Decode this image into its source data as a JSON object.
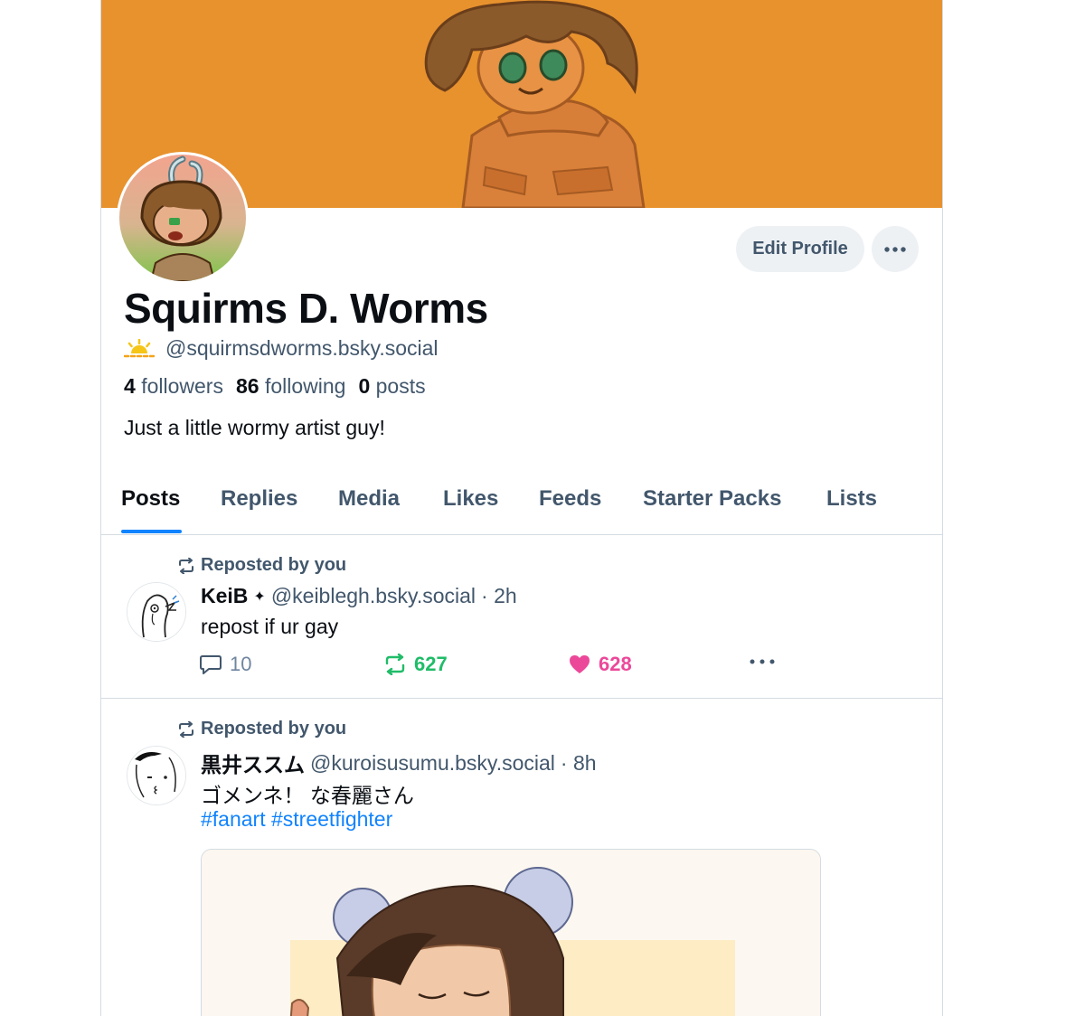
{
  "profile": {
    "display_name": "Squirms D. Worms",
    "handle": "@squirmsdworms.bsky.social",
    "followers_count": "4",
    "followers_label": "followers",
    "following_count": "86",
    "following_label": "following",
    "posts_count": "0",
    "posts_label": "posts",
    "bio": "Just a little wormy artist guy!",
    "edit_label": "Edit Profile"
  },
  "tabs": [
    {
      "label": "Posts",
      "active": true
    },
    {
      "label": "Replies"
    },
    {
      "label": "Media"
    },
    {
      "label": "Likes"
    },
    {
      "label": "Feeds"
    },
    {
      "label": "Starter Packs"
    },
    {
      "label": "Lists"
    }
  ],
  "posts": [
    {
      "repost_label": "Reposted by you",
      "author": "KeiB",
      "author_badge": "✦",
      "handle": "@keiblegh.bsky.social",
      "time": "· 2h",
      "text": "repost if ur gay",
      "replies": "10",
      "reposts": "627",
      "likes": "628"
    },
    {
      "repost_label": "Reposted by you",
      "author": "黒井ススム",
      "handle": "@kuroisusumu.bsky.social",
      "time": "· 8h",
      "text": "ゴメンネ！ な春麗さん",
      "tags": [
        "#fanart",
        "#streetfighter"
      ]
    }
  ],
  "colors": {
    "banner": "#e8922e",
    "accent": "#1083fe",
    "repost_green": "#20bc68",
    "like_pink": "#ec4899",
    "muted": "#42576c"
  },
  "icons": [
    "sun-icon",
    "more-icon",
    "repost-icon",
    "reply-icon",
    "heart-icon"
  ]
}
